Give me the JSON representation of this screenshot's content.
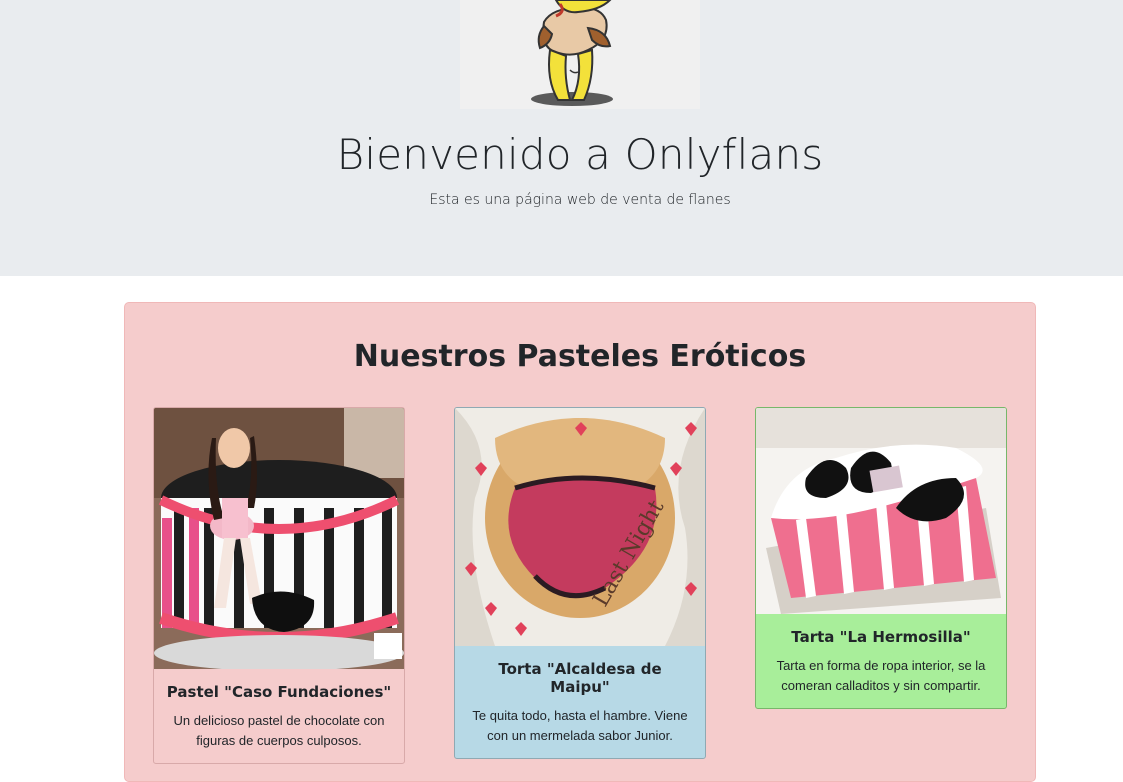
{
  "hero": {
    "title": "Bienvenido a Onlyflans",
    "subtitle": "Esta es una página web de venta de flanes"
  },
  "section": {
    "title": "Nuestros Pasteles Eróticos"
  },
  "cards": [
    {
      "title": "Pastel \"Caso Fundaciones\"",
      "text": "Un delicioso pastel de chocolate con figuras de cuerpos culposos.",
      "color": "#f5cccc"
    },
    {
      "title": "Torta \"Alcaldesa de Maipu\"",
      "text": "Te quita todo, hasta el hambre. Viene con un mermelada sabor Junior.",
      "color": "#b7d9e6"
    },
    {
      "title": "Tarta \"La Hermosilla\"",
      "text": "Tarta en forma de ropa interior, se la comeran calladitos y sin compartir.",
      "color": "#a8ee9a"
    }
  ]
}
